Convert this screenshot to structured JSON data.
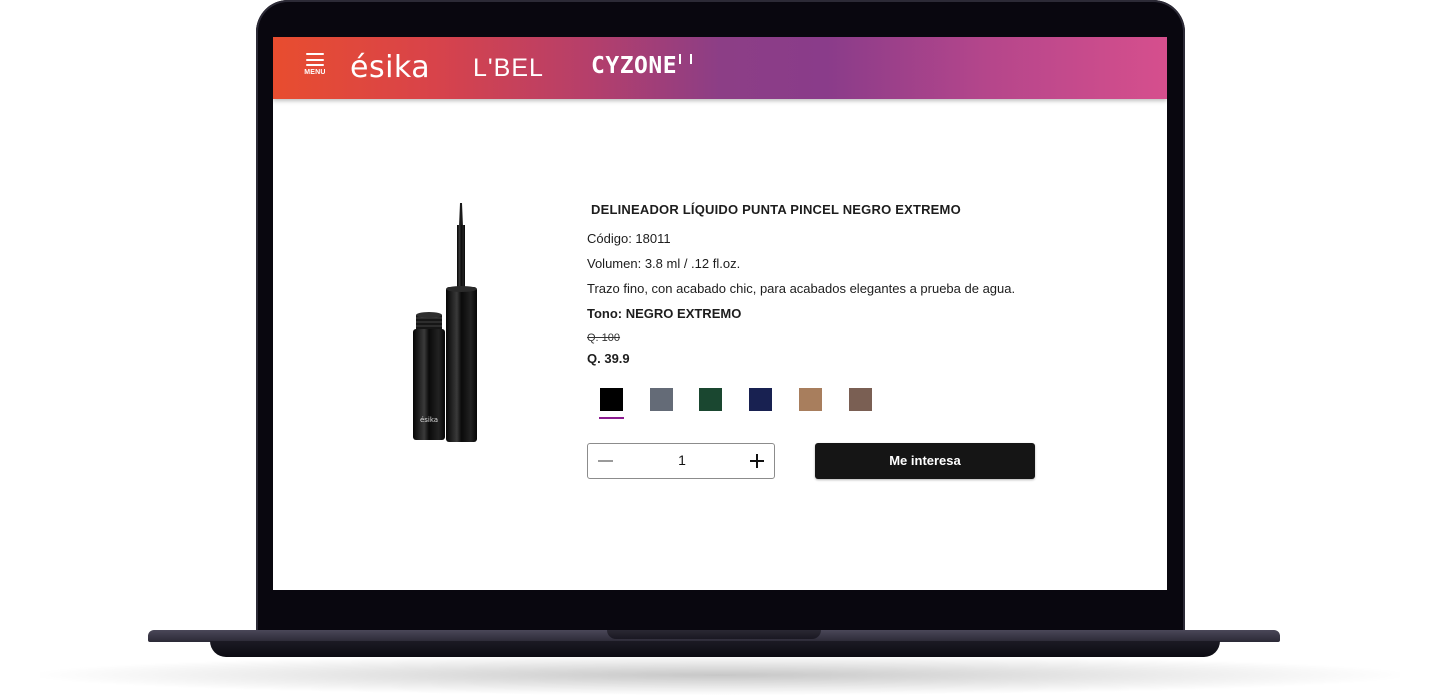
{
  "header": {
    "menu_label": "MENU",
    "brands": [
      "ésika",
      "L'BEL",
      "CYZONE"
    ]
  },
  "product": {
    "image_icon": "eyeliner-product-icon",
    "image_brand_text": "ésika",
    "title": "DELINEADOR LÍQUIDO PUNTA PINCEL NEGRO EXTREMO",
    "code": "Código: 18011",
    "volume": "Volumen: 3.8 ml / .12 fl.oz.",
    "description": "Trazo fino, con acabado chic, para acabados elegantes a prueba de agua.",
    "tone": "Tono: NEGRO EXTREMO",
    "old_price": "Q. 100",
    "price": "Q. 39.9",
    "swatches": [
      {
        "color": "#000000",
        "selected": true
      },
      {
        "color": "#646b77",
        "selected": false
      },
      {
        "color": "#1a4730",
        "selected": false
      },
      {
        "color": "#182151",
        "selected": false
      },
      {
        "color": "#a87e5d",
        "selected": false
      },
      {
        "color": "#7a5f53",
        "selected": false
      }
    ],
    "selected_accent": "#8b1a8f",
    "quantity": "1",
    "cta_label": "Me interesa"
  }
}
